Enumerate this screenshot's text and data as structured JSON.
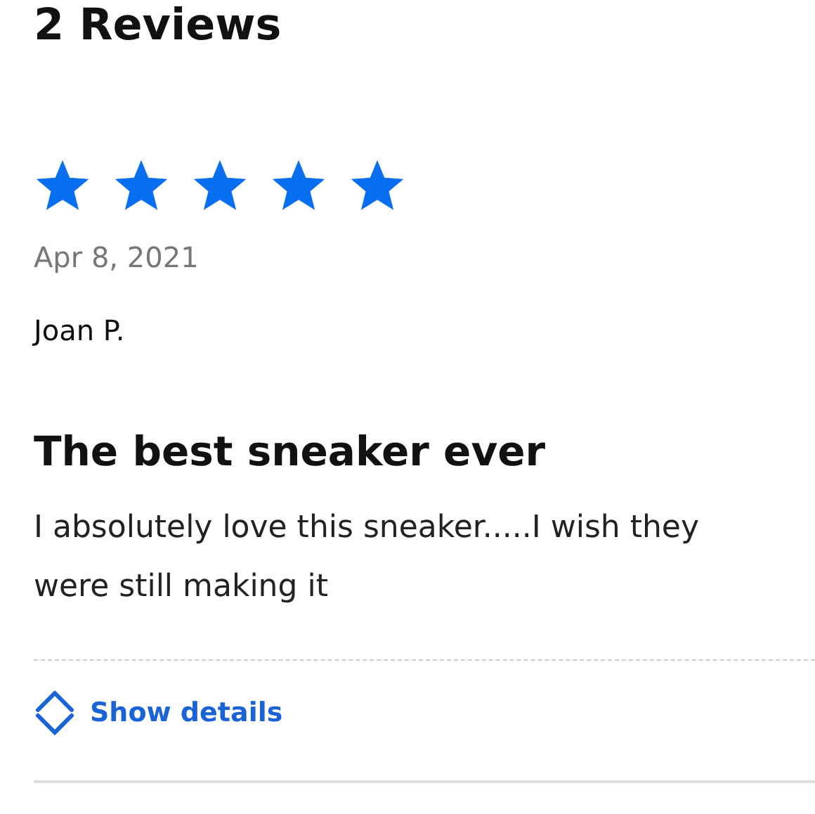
{
  "heading": "2 Reviews",
  "review": {
    "stars": 5,
    "date": "Apr 8, 2021",
    "author": "Joan P.",
    "title": "The best sneaker ever",
    "body": "I absolutely love this sneaker.....I wish they were still making it"
  },
  "details_link": "Show details"
}
